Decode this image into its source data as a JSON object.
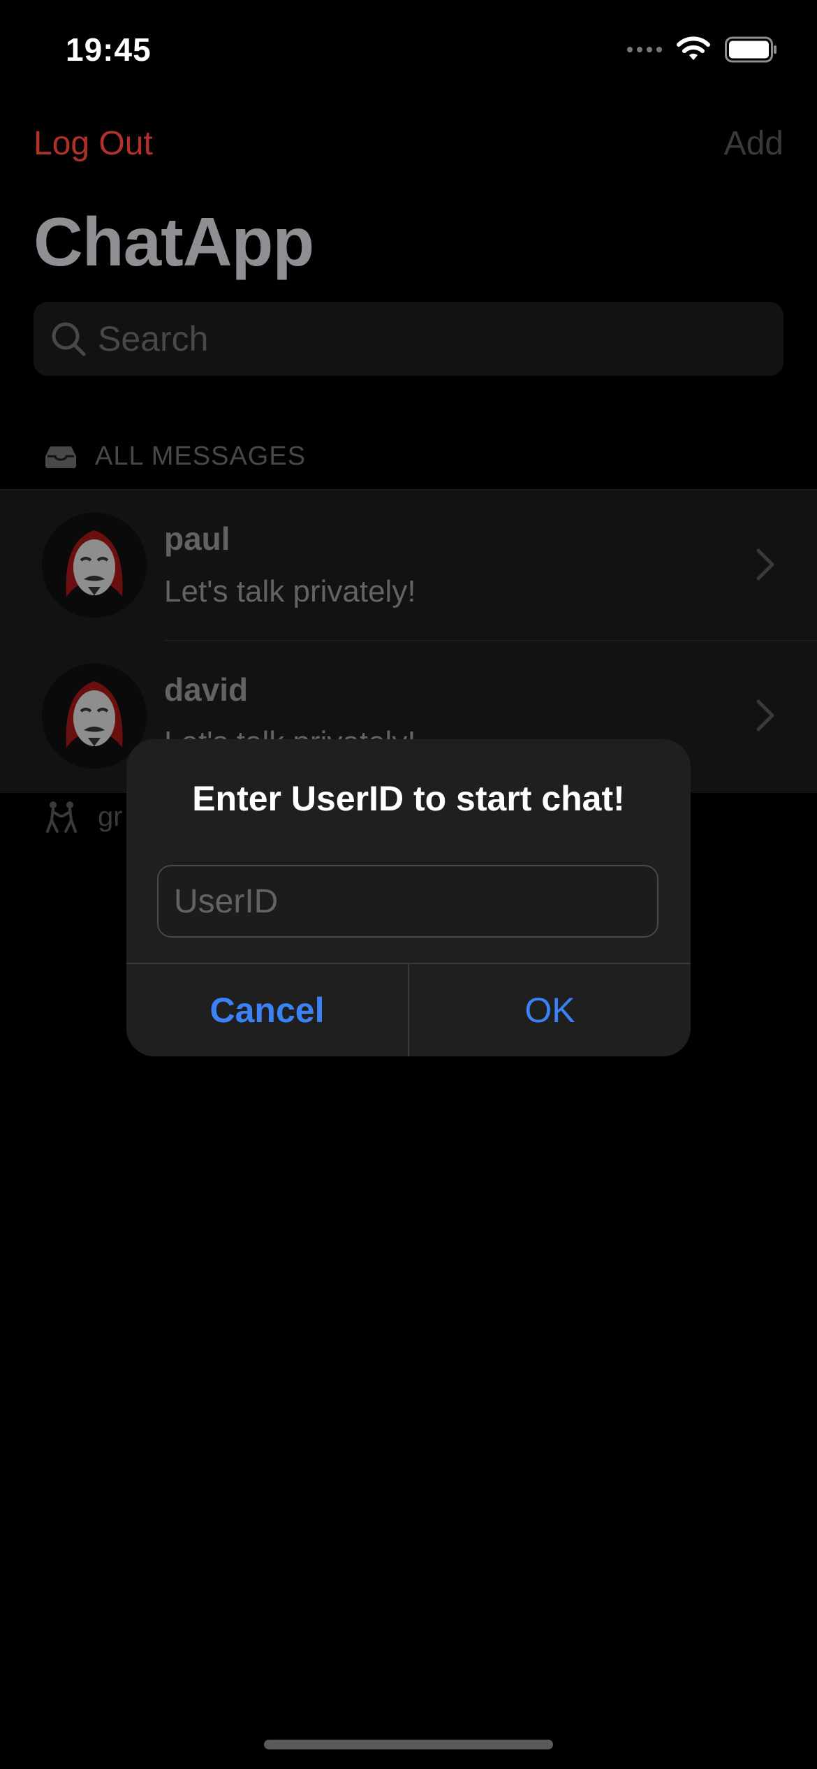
{
  "status_bar": {
    "time": "19:45"
  },
  "nav": {
    "left_button": "Log Out",
    "right_button": "Add",
    "title": "ChatApp"
  },
  "search": {
    "placeholder": "Search"
  },
  "sections": {
    "all_messages": "ALL MESSAGES",
    "groups_partial": "gr"
  },
  "chats": [
    {
      "name": "paul",
      "last_message": "Let's talk privately!"
    },
    {
      "name": "david",
      "last_message": "Let's talk privately!"
    }
  ],
  "alert": {
    "title": "Enter UserID to start chat!",
    "input_placeholder": "UserID",
    "input_value": "",
    "cancel": "Cancel",
    "ok": "OK"
  },
  "colors": {
    "destructive": "#b3312b",
    "accent": "#3b82f6",
    "background": "#000000"
  },
  "icons": [
    "wifi-icon",
    "battery-icon",
    "search-icon",
    "tray-icon",
    "chevron-right-icon",
    "dancing-people-icon",
    "mask-avatar-icon"
  ]
}
